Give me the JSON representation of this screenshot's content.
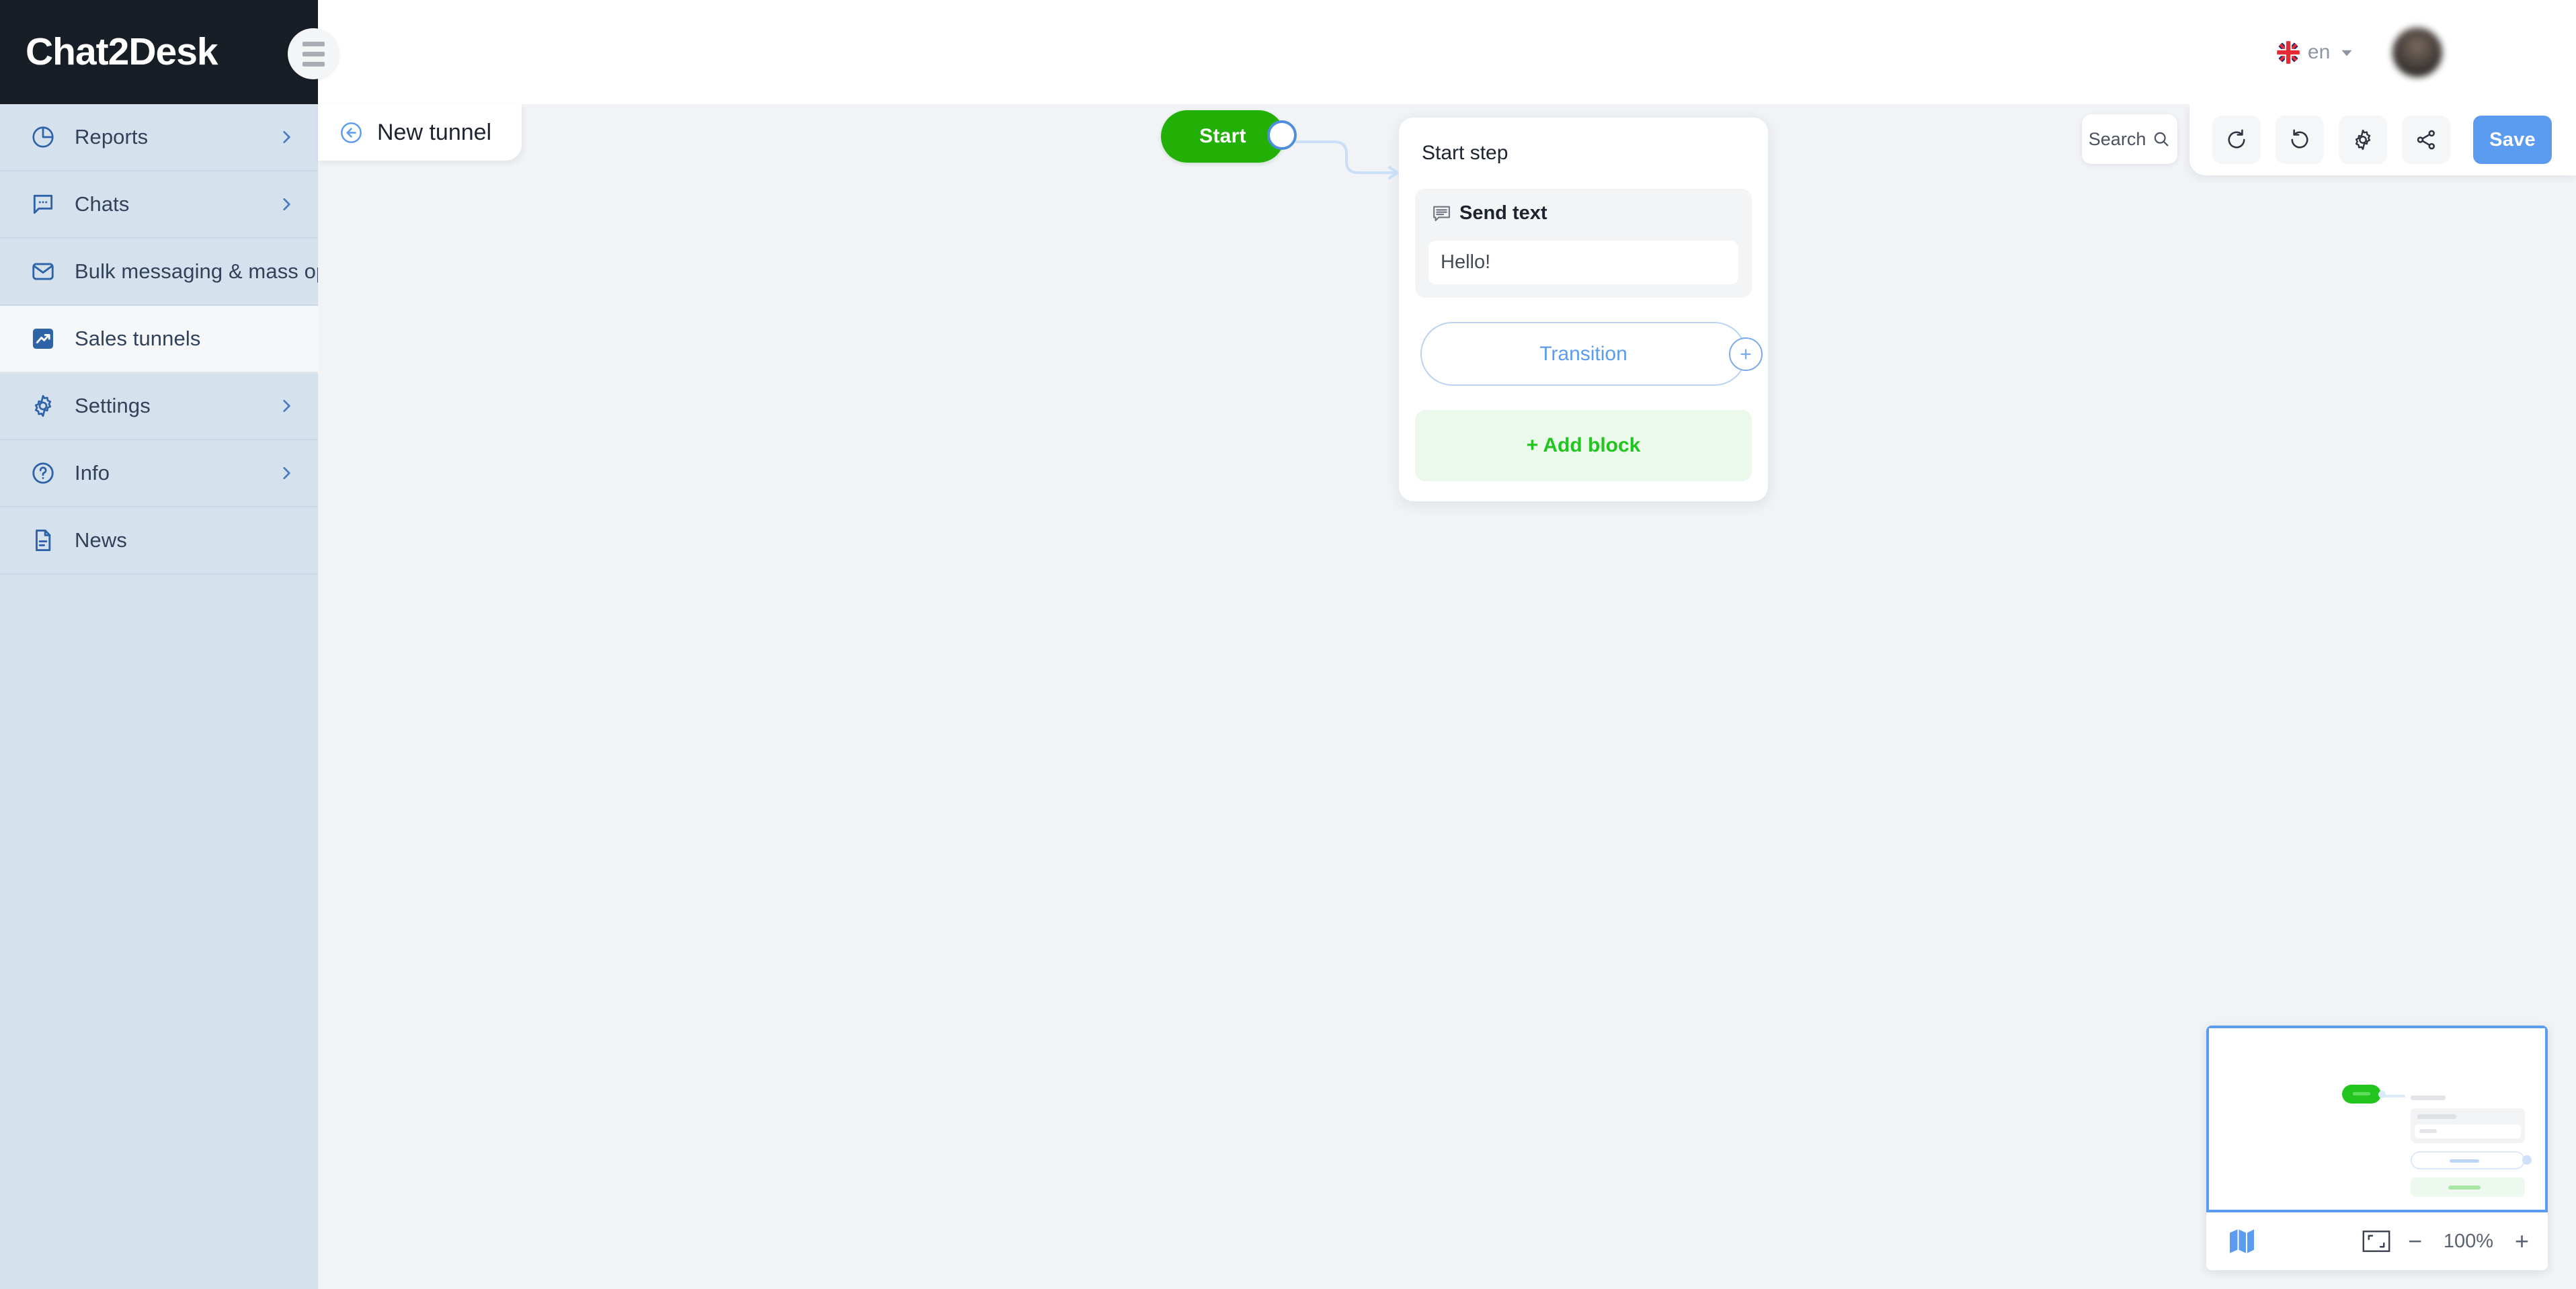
{
  "app": {
    "logo": "Chat2Desk",
    "menu_toggle_icon": "hamburger-icon"
  },
  "sidebar": {
    "items": [
      {
        "label": "Reports",
        "icon": "pie-chart-icon",
        "has_chevron": true,
        "active": false
      },
      {
        "label": "Chats",
        "icon": "chat-bubble-icon",
        "has_chevron": true,
        "active": false
      },
      {
        "label": "Bulk messaging & mass ops",
        "icon": "envelope-icon",
        "has_chevron": false,
        "active": false
      },
      {
        "label": "Sales tunnels",
        "icon": "trend-arrow-icon",
        "has_chevron": false,
        "active": true
      },
      {
        "label": "Settings",
        "icon": "gear-icon",
        "has_chevron": true,
        "active": false
      },
      {
        "label": "Info",
        "icon": "question-circle-icon",
        "has_chevron": true,
        "active": false
      },
      {
        "label": "News",
        "icon": "document-icon",
        "has_chevron": false,
        "active": false
      }
    ]
  },
  "topbar": {
    "language": {
      "code": "en",
      "flag_icon": "uk-flag-icon",
      "caret_icon": "chevron-down-icon"
    },
    "user": {
      "name": "",
      "avatar_icon": "user-avatar"
    }
  },
  "tunnel_header": {
    "back_icon": "arrow-left-circle-icon",
    "title": "New tunnel"
  },
  "toolbar": {
    "search": {
      "label": "Search",
      "placeholder": "Search",
      "icon": "search-icon"
    },
    "buttons": [
      {
        "name": "undo",
        "icon": "undo-icon"
      },
      {
        "name": "redo",
        "icon": "redo-icon"
      },
      {
        "name": "settings",
        "icon": "gear-icon"
      },
      {
        "name": "share",
        "icon": "share-icon"
      }
    ],
    "save_label": "Save"
  },
  "flow": {
    "start_node": {
      "label": "Start",
      "color": "#22b007"
    },
    "step_card": {
      "title": "Start step",
      "block": {
        "type_label": "Send text",
        "type_icon": "message-lines-icon",
        "text": "Hello!"
      },
      "transition_label": "Transition",
      "transition_plus_icon": "plus-circle-icon",
      "add_block_label": "+ Add block"
    }
  },
  "minimap": {
    "map_icon": "map-icon",
    "fit_icon": "fit-to-screen-icon",
    "zoom_out_label": "−",
    "zoom_level": "100%",
    "zoom_in_label": "+"
  },
  "colors": {
    "accent_blue": "#5b9bf0",
    "accent_green": "#22b007",
    "sidebar_bg": "#d5e1ed",
    "canvas_bg": "#f1f3f6",
    "logo_bg": "#171e26"
  }
}
